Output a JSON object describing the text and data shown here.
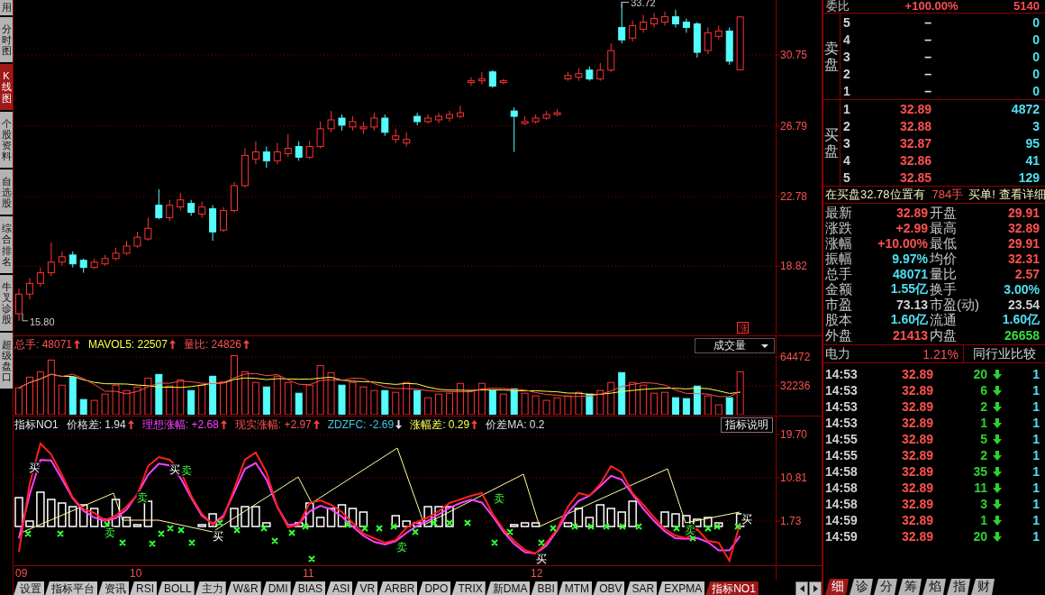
{
  "sidebar": {
    "tabs": [
      {
        "label": "用",
        "selected": false
      },
      {
        "label": "分时图",
        "selected": false
      },
      {
        "label": "K线图",
        "selected": true
      },
      {
        "label": "个股资料",
        "selected": false
      },
      {
        "label": "自选股",
        "selected": false
      },
      {
        "label": "综合排名",
        "selected": false
      },
      {
        "label": "牛叉诊股",
        "selected": false
      },
      {
        "label": "超级盘口",
        "selected": false
      }
    ]
  },
  "price_chart": {
    "axis_labels": [
      "30.75",
      "26.79",
      "22.78",
      "18.82"
    ],
    "high_label": "33.72",
    "low_label": "15.80",
    "limit_badge": "涨"
  },
  "volume_panel": {
    "indicators": [
      {
        "label": "总手:",
        "value": "48071",
        "up": true,
        "color": "#ff5050"
      },
      {
        "label": "MAVOL5:",
        "value": "22507",
        "up": true,
        "color": "#ffff54"
      },
      {
        "label": "量比:",
        "value": "24826",
        "up": true,
        "color": "#ff5050"
      }
    ],
    "selector": "成交量",
    "axis_labels": [
      "64472",
      "32236"
    ]
  },
  "indicator_panel": {
    "name": "指标NO1",
    "indicators": [
      {
        "label": "价格差:",
        "value": "1.94",
        "up": true,
        "color": "#e0e0e0"
      },
      {
        "label": "理想涨幅:",
        "value": "+2.68",
        "up": true,
        "color": "#ff40ff"
      },
      {
        "label": "现实涨幅:",
        "value": "+2.97",
        "up": true,
        "color": "#ff5050"
      },
      {
        "label": "ZDZFC:",
        "value": "-2.69",
        "up": false,
        "color": "#40c8e0"
      },
      {
        "label": "涨幅差:",
        "value": "0.29",
        "up": true,
        "color": "#ffff54"
      },
      {
        "label": "价差MA:",
        "value": "0.2",
        "color": "#e0e0e0"
      }
    ],
    "help_button": "指标说明",
    "axis_labels": [
      "19.70",
      "10.81",
      "1.73"
    ],
    "signals": [
      {
        "text": "买",
        "kind": "buy"
      },
      {
        "text": "买",
        "kind": "buy"
      },
      {
        "text": "卖",
        "kind": "sell"
      },
      {
        "text": "卖",
        "kind": "sell"
      },
      {
        "text": "卖",
        "kind": "sell"
      },
      {
        "text": "买",
        "kind": "buy"
      },
      {
        "text": "卖",
        "kind": "sell"
      },
      {
        "text": "卖",
        "kind": "sell"
      },
      {
        "text": "买",
        "kind": "buy"
      },
      {
        "text": "卖",
        "kind": "sell"
      },
      {
        "text": "买",
        "kind": "buy"
      }
    ]
  },
  "date_axis": [
    "09",
    "10",
    "11",
    "12"
  ],
  "indicator_tabs": [
    {
      "label": "设置",
      "selected": false
    },
    {
      "label": "指标平台",
      "selected": false
    },
    {
      "label": "资讯",
      "selected": false
    },
    {
      "label": "RSI",
      "selected": false
    },
    {
      "label": "BOLL",
      "selected": false
    },
    {
      "label": "主力",
      "selected": false
    },
    {
      "label": "W&R",
      "selected": false
    },
    {
      "label": "DMI",
      "selected": false
    },
    {
      "label": "BIAS",
      "selected": false
    },
    {
      "label": "ASI",
      "selected": false
    },
    {
      "label": "VR",
      "selected": false
    },
    {
      "label": "ARBR",
      "selected": false
    },
    {
      "label": "DPO",
      "selected": false
    },
    {
      "label": "TRIX",
      "selected": false
    },
    {
      "label": "新DMA",
      "selected": false
    },
    {
      "label": "BBI",
      "selected": false
    },
    {
      "label": "MTM",
      "selected": false
    },
    {
      "label": "OBV",
      "selected": false
    },
    {
      "label": "SAR",
      "selected": false
    },
    {
      "label": "EXPMA",
      "selected": false
    },
    {
      "label": "指标NO1",
      "selected": true
    }
  ],
  "quote_panel": {
    "summary": {
      "label": "委比",
      "ratio": "+100.00%",
      "difference": "5140"
    },
    "sell_label": "卖盘",
    "sell_orders": [
      {
        "rank": "5",
        "price": "–",
        "volume": "0"
      },
      {
        "rank": "4",
        "price": "–",
        "volume": "0"
      },
      {
        "rank": "3",
        "price": "–",
        "volume": "0"
      },
      {
        "rank": "2",
        "price": "–",
        "volume": "0"
      },
      {
        "rank": "1",
        "price": "–",
        "volume": "0"
      }
    ],
    "buy_label": "买盘",
    "buy_orders": [
      {
        "rank": "1",
        "price": "32.89",
        "volume": "4872"
      },
      {
        "rank": "2",
        "price": "32.88",
        "volume": "3"
      },
      {
        "rank": "3",
        "price": "32.87",
        "volume": "95"
      },
      {
        "rank": "4",
        "price": "32.86",
        "volume": "41"
      },
      {
        "rank": "5",
        "price": "32.85",
        "volume": "129"
      }
    ],
    "notice": {
      "text": "在买盘32.78位置有",
      "amount": "784手",
      "suffix": "买单!",
      "link": "查看详细"
    },
    "stats": [
      {
        "label": "最新",
        "value": "32.89",
        "color": "#ff5050"
      },
      {
        "label": "开盘",
        "value": "29.91",
        "color": "#ff5050"
      },
      {
        "label": "涨跌",
        "value": "+2.99",
        "color": "#ff5050"
      },
      {
        "label": "最高",
        "value": "32.89",
        "color": "#ff5050"
      },
      {
        "label": "涨幅",
        "value": "+10.00%",
        "color": "#ff5050"
      },
      {
        "label": "最低",
        "value": "29.91",
        "color": "#ff5050"
      },
      {
        "label": "振幅",
        "value": "9.97%",
        "color": "#4fe0f0"
      },
      {
        "label": "均价",
        "value": "32.31",
        "color": "#ff5050"
      },
      {
        "label": "总手",
        "value": "48071",
        "color": "#4fe0f0"
      },
      {
        "label": "量比",
        "value": "2.57",
        "color": "#ff5050"
      },
      {
        "label": "金额",
        "value": "1.55亿",
        "color": "#4fe0f0"
      },
      {
        "label": "换手",
        "value": "3.00%",
        "color": "#4fe0f0"
      },
      {
        "label": "市盈",
        "value": "73.13",
        "color": "#d0d0d0"
      },
      {
        "label": "市盈(动)",
        "value": "23.54",
        "color": "#d0d0d0"
      },
      {
        "label": "股本",
        "value": "1.60亿",
        "color": "#4fe0f0"
      },
      {
        "label": "流通",
        "value": "1.60亿",
        "color": "#4fe0f0"
      },
      {
        "label": "外盘",
        "value": "21413",
        "color": "#ff5050"
      },
      {
        "label": "内盘",
        "value": "26658",
        "color": "#3cdc3c"
      }
    ],
    "sector": {
      "label": "电力",
      "value": "1.21%",
      "button": "同行业比较"
    },
    "trades": [
      {
        "time": "14:53",
        "price": "32.89",
        "volume": "20",
        "up": false,
        "column_5": "1"
      },
      {
        "time": "14:53",
        "price": "32.89",
        "volume": "6",
        "up": false,
        "column_5": "1"
      },
      {
        "time": "14:53",
        "price": "32.89",
        "volume": "2",
        "up": false,
        "column_5": "1"
      },
      {
        "time": "14:53",
        "price": "32.89",
        "volume": "1",
        "up": false,
        "column_5": "1"
      },
      {
        "time": "14:55",
        "price": "32.89",
        "volume": "5",
        "up": false,
        "column_5": "1"
      },
      {
        "time": "14:55",
        "price": "32.89",
        "volume": "2",
        "up": false,
        "column_5": "1"
      },
      {
        "time": "14:58",
        "price": "32.89",
        "volume": "35",
        "up": false,
        "column_5": "1"
      },
      {
        "time": "14:58",
        "price": "32.89",
        "volume": "11",
        "up": false,
        "column_5": "1"
      },
      {
        "time": "14:58",
        "price": "32.89",
        "volume": "3",
        "up": false,
        "column_5": "1"
      },
      {
        "time": "14:59",
        "price": "32.89",
        "volume": "1",
        "up": false,
        "column_5": "1"
      },
      {
        "time": "14:59",
        "price": "32.89",
        "volume": "20",
        "up": false,
        "column_5": "1"
      }
    ],
    "tabs": [
      {
        "label": "细",
        "selected": true
      },
      {
        "label": "诊",
        "selected": false
      },
      {
        "label": "分",
        "selected": false
      },
      {
        "label": "筹",
        "selected": false
      },
      {
        "label": "焰",
        "selected": false
      },
      {
        "label": "指",
        "selected": false
      },
      {
        "label": "财",
        "selected": false
      }
    ]
  }
}
